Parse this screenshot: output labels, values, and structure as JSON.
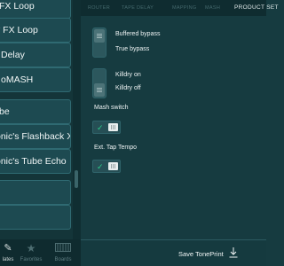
{
  "presets": {
    "items": [
      {
        "label": "FX Loop"
      },
      {
        "label": "v FX Loop"
      },
      {
        "label": "Delay"
      },
      {
        "label": "oMASH"
      },
      {
        "label": "be"
      },
      {
        "label": "onic's Flashback X..."
      },
      {
        "label": "onic's Tube Echo"
      },
      {
        "label": ""
      },
      {
        "label": ""
      }
    ]
  },
  "nav": {
    "tabs": [
      {
        "label": "lates",
        "icon": "pencil-icon"
      },
      {
        "label": "Favorites",
        "icon": "star-icon"
      },
      {
        "label": "Boards",
        "icon": "keyboard-icon"
      }
    ]
  },
  "tabs": [
    {
      "label": "ROUTER"
    },
    {
      "label": "TAPE DELAY"
    },
    {
      "label": "MAPPING"
    },
    {
      "label": "MASH"
    },
    {
      "label": "PRODUCT SET"
    }
  ],
  "settings": {
    "bypass": {
      "option_on": "Buffered bypass",
      "option_off": "True bypass",
      "selected": "Buffered bypass"
    },
    "killdry": {
      "option_on": "Killdry on",
      "option_off": "Killdry off",
      "selected": "Killdry off"
    },
    "mash_switch": {
      "title": "Mash switch",
      "enabled": true
    },
    "tap_tempo": {
      "title": "Ext. Tap Tempo",
      "enabled": true
    }
  },
  "save": {
    "label": "Save TonePrint",
    "icon": "download-icon"
  },
  "colors": {
    "accent_check": "#2bd08a",
    "background": "#163b40"
  }
}
